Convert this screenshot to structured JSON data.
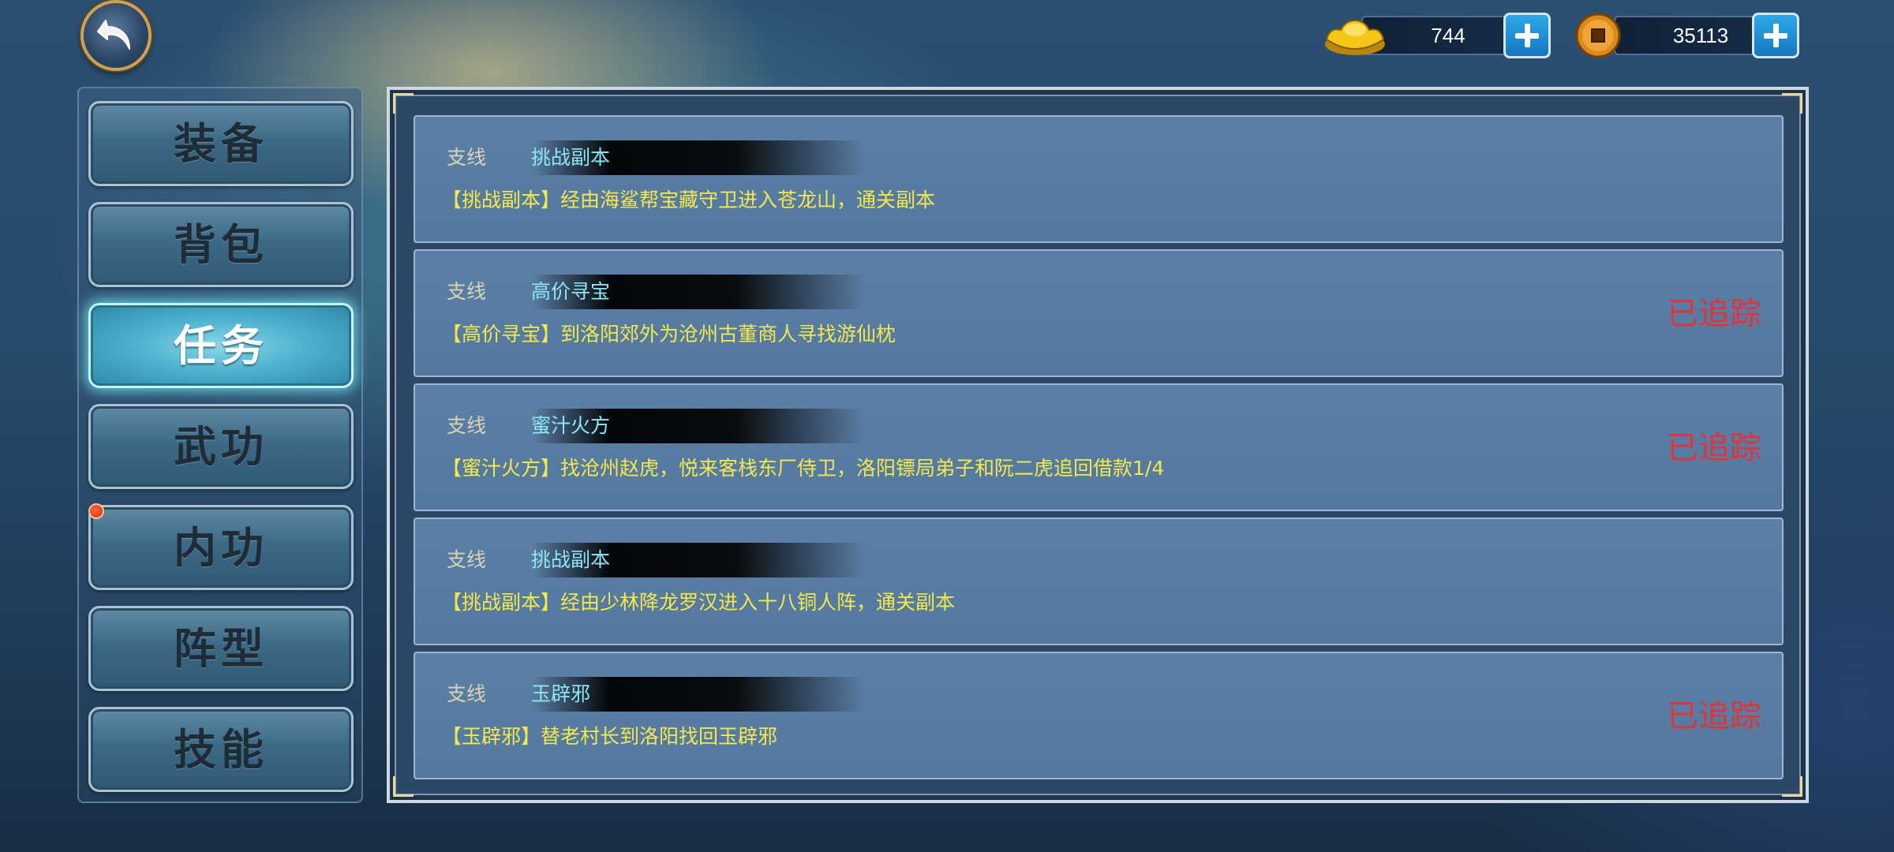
{
  "currency": {
    "gold_ingot": "744",
    "copper_coin": "35113"
  },
  "sidebar": {
    "items": [
      {
        "label": "装备"
      },
      {
        "label": "背包"
      },
      {
        "label": "任务",
        "active": true
      },
      {
        "label": "武功"
      },
      {
        "label": "内功",
        "notification": true
      },
      {
        "label": "阵型"
      },
      {
        "label": "技能"
      }
    ]
  },
  "quests": [
    {
      "type": "支线",
      "name": "挑战副本",
      "description": "【挑战副本】经由海鲨帮宝藏守卫进入苍龙山，通关副本",
      "tracked": ""
    },
    {
      "type": "支线",
      "name": "高价寻宝",
      "description": "【高价寻宝】到洛阳郊外为沧州古董商人寻找游仙枕",
      "tracked": "已追踪"
    },
    {
      "type": "支线",
      "name": "蜜汁火方",
      "description": "【蜜汁火方】找沧州赵虎，悦来客栈东厂侍卫，洛阳镖局弟子和阮二虎追回借款1/4",
      "tracked": "已追踪"
    },
    {
      "type": "支线",
      "name": "挑战副本",
      "description": "【挑战副本】经由少林降龙罗汉进入十八铜人阵，通关副本",
      "tracked": ""
    },
    {
      "type": "支线",
      "name": "玉辟邪",
      "description": "【玉辟邪】替老村长到洛阳找回玉辟邪",
      "tracked": "已追踪"
    }
  ],
  "colors": {
    "accent_cyan": "#8ee6f5",
    "description_yellow": "#f4e84a",
    "tracked_red": "#e2333a",
    "active_tab_glow": "#78ebff"
  },
  "icons": [
    "back-arrow-icon",
    "gold-ingot-icon",
    "copper-coin-icon",
    "plus-icon",
    "notification-dot-icon"
  ]
}
